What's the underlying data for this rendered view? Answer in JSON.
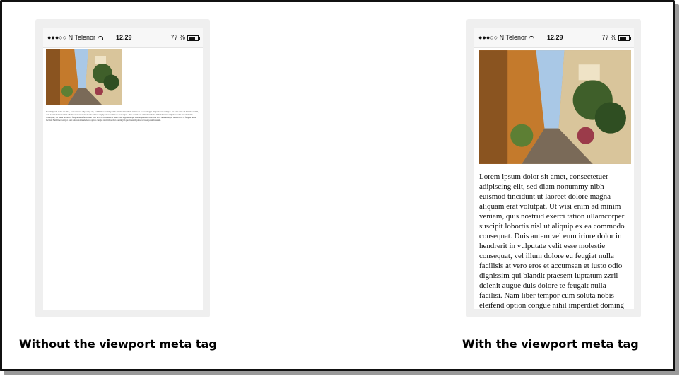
{
  "left_phone": {
    "carrier": "●●●○○ N Telenor",
    "time": "12.29",
    "battery": "77 %",
    "body_text": "Lorem ipsum dolor sit amet, consectetuer adipiscing elit, sed diam nonummy nibh euismod tincidunt ut laoreet dolore magna aliquam erat volutpat. Ut wisi enim ad minim veniam, quis nostrud exerci tation ullamcorper suscipit lobortis nisl ut aliquip ex ea commodo consequat. Duis autem vel eum iriure dolor in hendrerit in vulputate velit esse molestie consequat, vel illum dolore eu feugiat nulla facilisis at vero eros et accumsan et iusto odio dignissim qui blandit praesent luptatum zzril delenit augue duis dolore te feugait nulla facilisi. Nam liber tempor cum soluta nobis eleifend option congue nihil imperdiet doming id quod mazim placerat facer possim assum."
  },
  "right_phone": {
    "carrier": "●●●○○ N Telenor",
    "time": "12.29",
    "battery": "77 %",
    "body_text": "Lorem ipsum dolor sit amet, consectetuer adipiscing elit, sed diam nonummy nibh euismod tincidunt ut laoreet dolore magna aliquam erat volutpat. Ut wisi enim ad minim veniam, quis nostrud exerci tation ullamcorper suscipit lobortis nisl ut aliquip ex ea commodo consequat. Duis autem vel eum iriure dolor in hendrerit in vulputate velit esse molestie consequat, vel illum dolore eu feugiat nulla facilisis at vero eros et accumsan et iusto odio dignissim qui blandit praesent luptatum zzril delenit augue duis dolore te feugait nulla facilisi. Nam liber tempor cum soluta nobis eleifend option congue nihil imperdiet doming"
  },
  "captions": {
    "left": "Without the viewport meta tag",
    "right": "With the viewport meta tag"
  },
  "icons": [
    "wifi-icon",
    "battery-icon",
    "alley-photo"
  ]
}
